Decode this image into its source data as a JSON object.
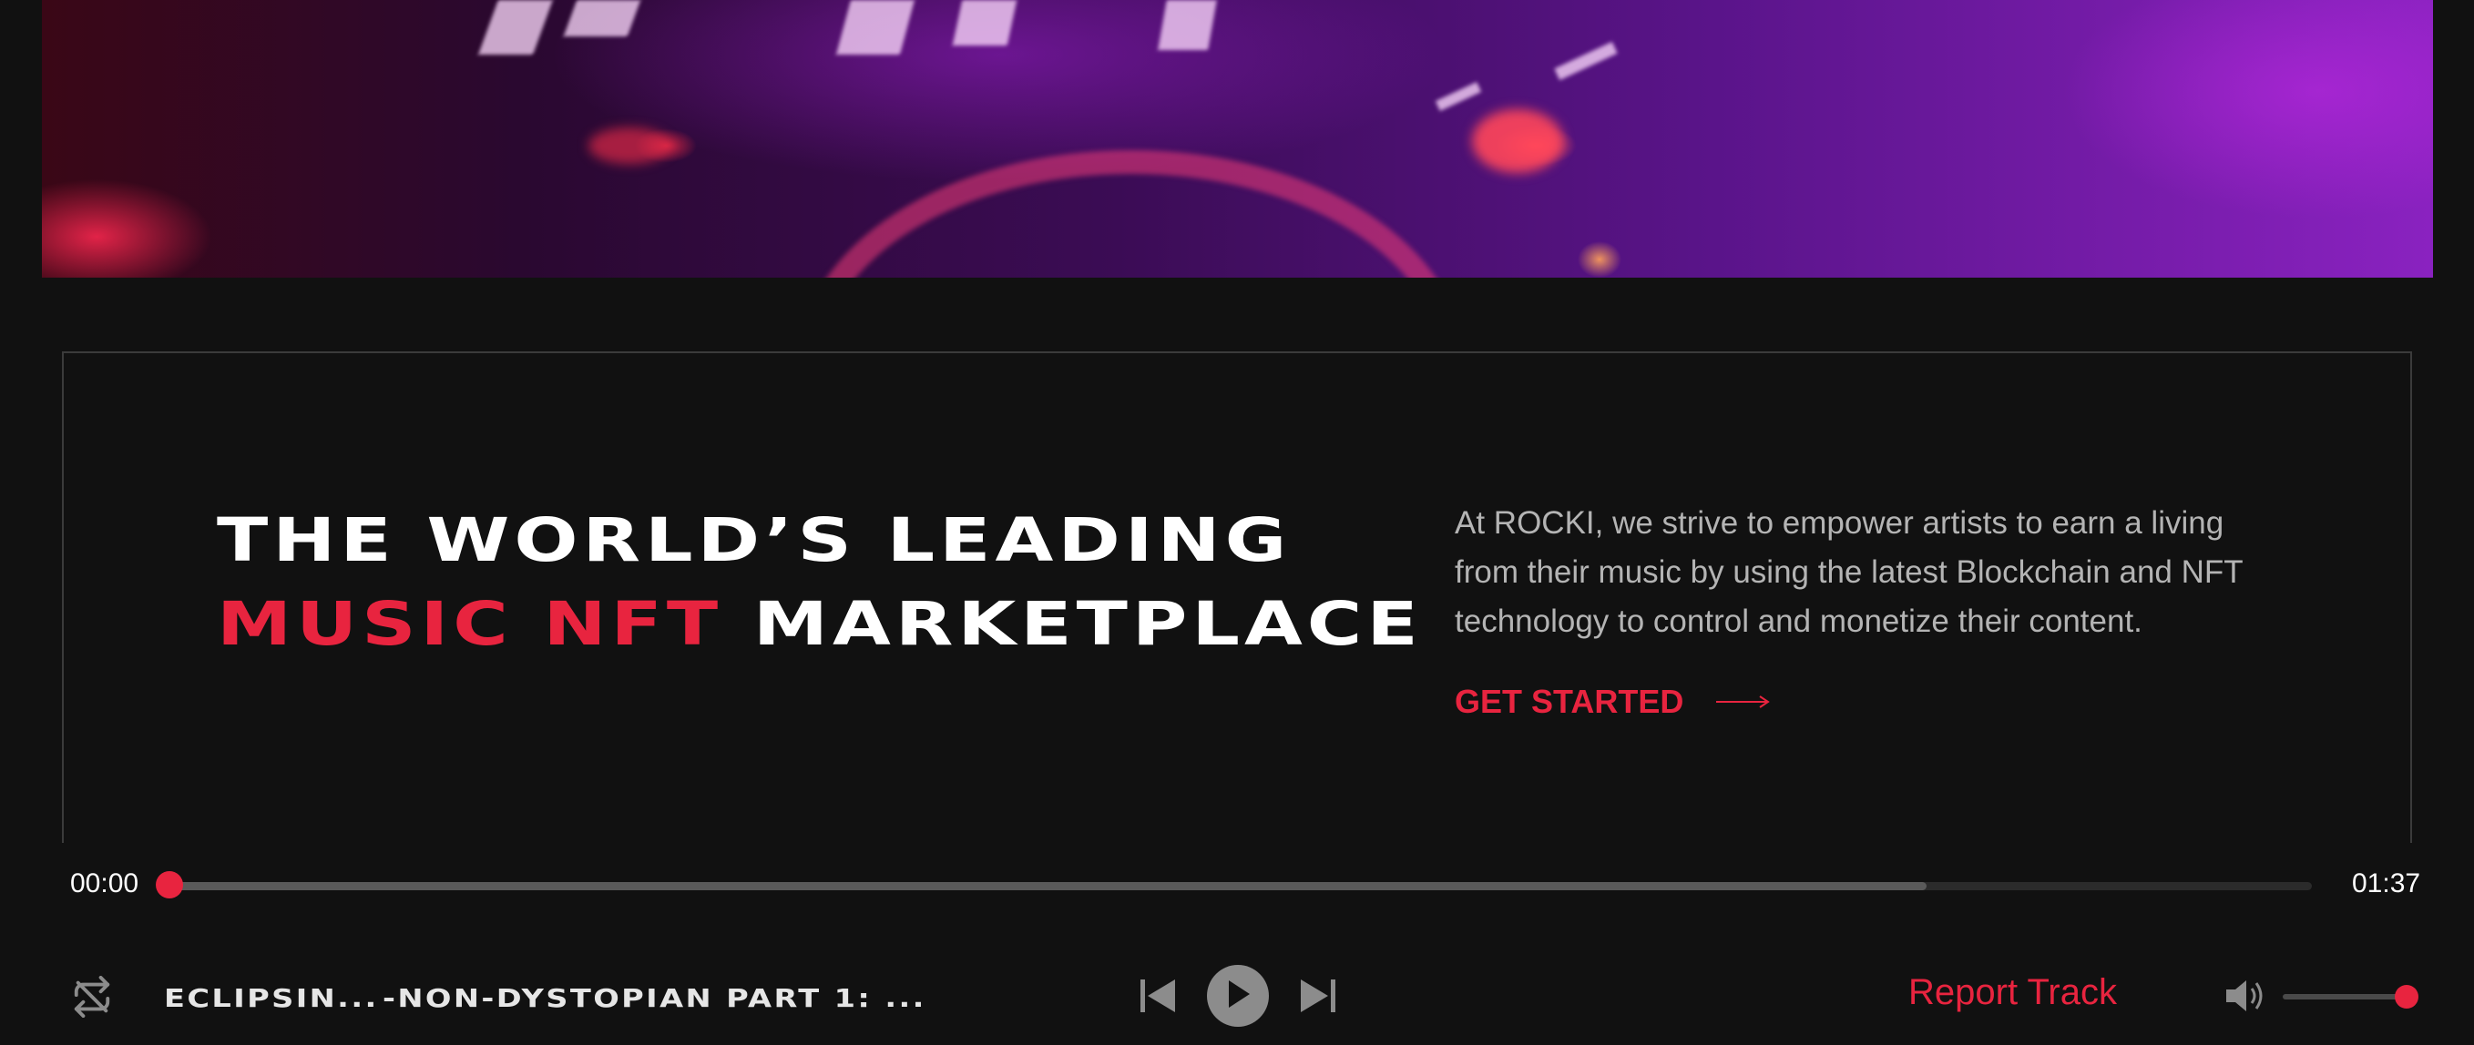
{
  "hero": {
    "headline_line1": "THE WORLD’S LEADING",
    "headline_accent": "MUSIC NFT",
    "headline_rest": "MARKETPLACE",
    "description": "At ROCKI, we strive to empower artists to earn a living from their music by using the latest Blockchain and NFT technology to control and monetize their content.",
    "cta_label": "GET STARTED",
    "cta_icon": "arrow-right-icon"
  },
  "player": {
    "current_time": "00:00",
    "duration": "01:37",
    "progress_fraction": 0.0,
    "buffered_fraction": 0.82,
    "track_artist": "ECLIPSIN...",
    "track_title": "-NON-DYSTOPIAN PART 1: ...",
    "report_label": "Report Track",
    "volume_fraction": 1.0,
    "icons": {
      "repeat": "repeat-icon",
      "previous": "skip-previous-icon",
      "play": "play-icon",
      "next": "skip-next-icon",
      "volume": "volume-icon"
    }
  },
  "colors": {
    "accent": "#e8243f",
    "background": "#111111",
    "text_muted": "#b4b4b4"
  }
}
